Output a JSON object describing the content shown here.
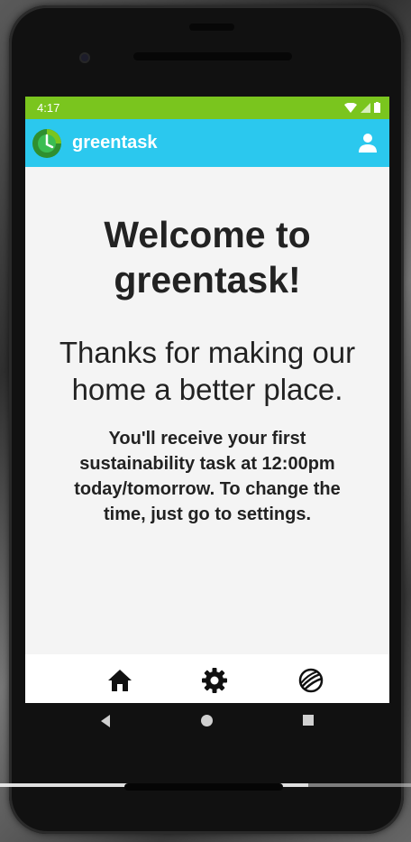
{
  "status_bar": {
    "time": "4:17"
  },
  "app_bar": {
    "title": "greentask",
    "account_icon": "account-icon",
    "logo_icon": "clock-logo-icon"
  },
  "main": {
    "welcome_line1": "Welcome to",
    "welcome_line2": "greentask!",
    "thanks_line1": "Thanks for making our",
    "thanks_line2": "home a better place.",
    "info_line1": "You'll receive your first",
    "info_line2": "sustainability task at 12:00pm",
    "info_line3": "today/tomorrow.  To change the",
    "info_line4": "time, just go to settings."
  },
  "bottom_nav": {
    "items": [
      {
        "icon": "home-icon"
      },
      {
        "icon": "gear-icon"
      },
      {
        "icon": "globe-icon"
      }
    ]
  },
  "system_nav": {
    "icons": [
      "back-icon",
      "home-circle-icon",
      "recents-icon"
    ]
  },
  "colors": {
    "status_bar": "#7ac51e",
    "app_bar": "#2bc8ee",
    "text": "#222222"
  },
  "video": {
    "progress": 0.75
  }
}
